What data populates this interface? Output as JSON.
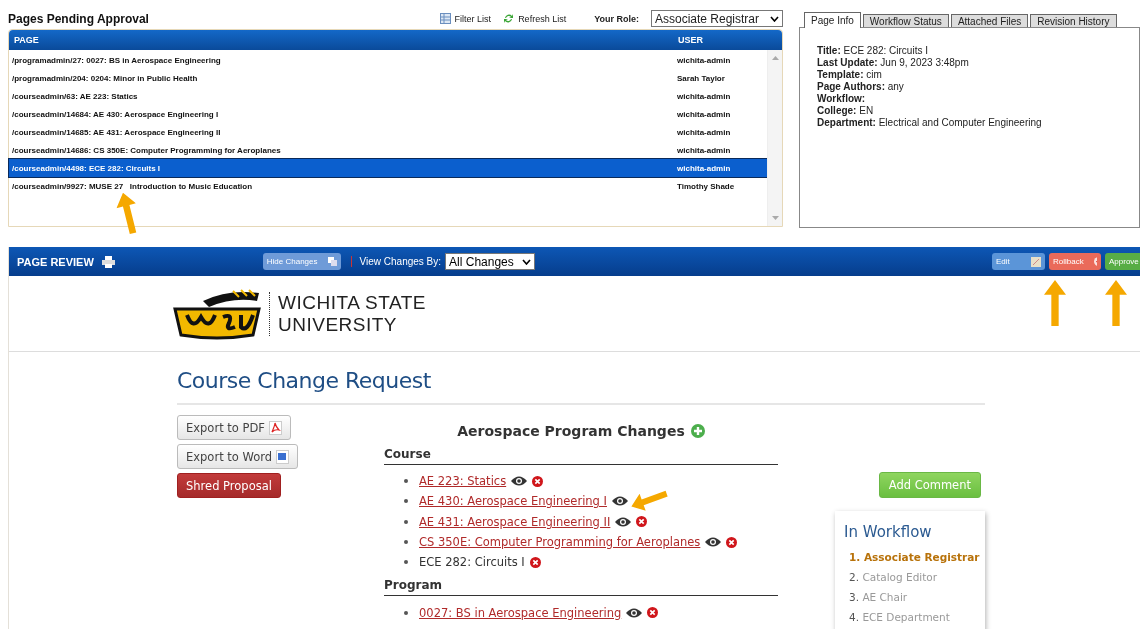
{
  "pending": {
    "title": "Pages Pending Approval",
    "tools": [
      {
        "label": "Filter List",
        "kind": "filter"
      },
      {
        "label": "Refresh List",
        "kind": "refresh"
      }
    ],
    "role_label": "Your Role:",
    "role": "Associate Registrar",
    "columns": [
      "PAGE",
      "USER"
    ],
    "rows": [
      {
        "page": "/programadmin/27: 0027: BS in Aerospace Engineering",
        "user": "wichita-admin",
        "selected": false
      },
      {
        "page": "/programadmin/204: 0204: Minor in Public Health",
        "user": "Sarah Taylor",
        "selected": false
      },
      {
        "page": "/courseadmin/63: AE 223: Statics",
        "user": "wichita-admin",
        "selected": false
      },
      {
        "page": "/courseadmin/14684: AE 430: Aerospace Engineering I",
        "user": "wichita-admin",
        "selected": false
      },
      {
        "page": "/courseadmin/14685: AE 431: Aerospace Engineering II",
        "user": "wichita-admin",
        "selected": false
      },
      {
        "page": "/courseadmin/14686: CS 350E: Computer Programming for Aeroplanes",
        "user": "wichita-admin",
        "selected": false
      },
      {
        "page": "/courseadmin/4498: ECE 282: Circuits I",
        "user": "wichita-admin",
        "selected": true
      },
      {
        "page": "/courseadmin/9927: MUSE 27   Introduction to Music Education",
        "user": "Timothy Shade",
        "selected": false
      }
    ]
  },
  "info": {
    "tabs": [
      {
        "label": "Page Info",
        "selected": true
      },
      {
        "label": "Workflow Status",
        "selected": false
      },
      {
        "label": "Attached Files",
        "selected": false
      },
      {
        "label": "Revision History",
        "selected": false
      }
    ],
    "fields": [
      {
        "label": "Title:",
        "value": "ECE 282: Circuits I"
      },
      {
        "label": "Last Update:",
        "value": "Jun 9, 2023 3:48pm"
      },
      {
        "label": "Template:",
        "value": "cim"
      },
      {
        "label": "Page Authors:",
        "value": "any"
      },
      {
        "label": "Workflow:"
      },
      {
        "label": "College:",
        "value": "EN"
      },
      {
        "label": "Department:",
        "value": "Electrical and Computer Engineering"
      }
    ]
  },
  "review": {
    "title": "PAGE REVIEW",
    "hide_changes": "Hide Changes",
    "view_by_label": "View Changes By:",
    "view_by": "All Changes",
    "actions": [
      {
        "label": "Edit",
        "kind": "edit"
      },
      {
        "label": "Rollback",
        "kind": "rollback"
      },
      {
        "label": "Approve",
        "kind": "approve"
      }
    ],
    "logo": {
      "line1": "WICHITA STATE",
      "line2": "UNIVERSITY"
    },
    "heading": "Course Change Request",
    "exports": [
      {
        "label": "Export to PDF",
        "kind": "pdf"
      },
      {
        "label": "Export to Word",
        "kind": "word"
      }
    ],
    "shred": "Shred Proposal",
    "changes_title": "Aerospace Program Changes",
    "sections": [
      {
        "title": "Course",
        "items": [
          {
            "label": "AE 223: Statics",
            "link": true,
            "view": true,
            "remove": true
          },
          {
            "label": "AE 430: Aerospace Engineering I",
            "link": true,
            "view": true,
            "remove": false
          },
          {
            "label": "AE 431: Aerospace Engineering II",
            "link": true,
            "view": true,
            "remove": true
          },
          {
            "label": "CS 350E: Computer Programming for Aeroplanes",
            "link": true,
            "view": true,
            "remove": true
          },
          {
            "label": "ECE 282: Circuits I",
            "link": false,
            "view": false,
            "remove": true
          }
        ]
      },
      {
        "title": "Program",
        "items": [
          {
            "label": "0027: BS in Aerospace Engineering",
            "link": true,
            "view": true,
            "remove": true
          }
        ]
      }
    ],
    "add_comment": "Add Comment",
    "workflow": {
      "title": "In Workflow",
      "steps": [
        {
          "number": "1.",
          "name": "Associate Registrar",
          "current": true
        },
        {
          "number": "2.",
          "name": "Catalog Editor",
          "current": false
        },
        {
          "number": "3.",
          "name": "AE Chair",
          "current": false
        },
        {
          "number": "4.",
          "name": "ECE Department",
          "current": false
        }
      ]
    }
  }
}
